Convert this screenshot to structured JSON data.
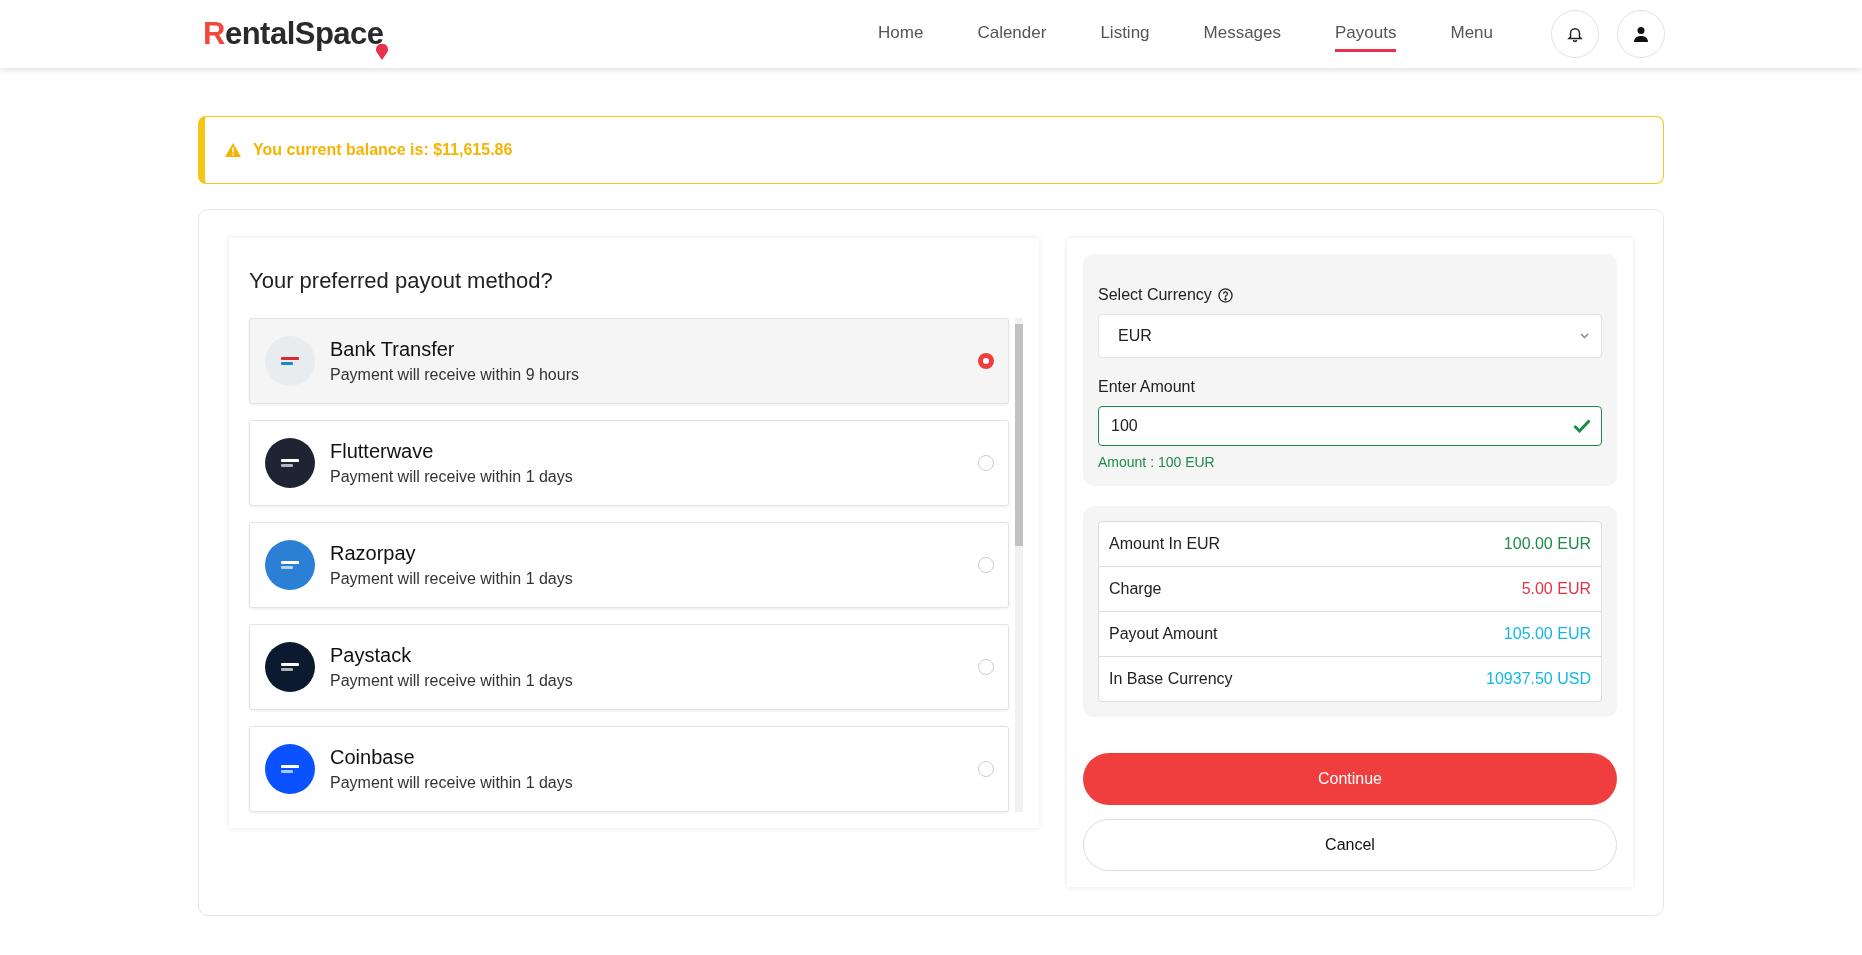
{
  "header": {
    "logo": "RentalSpace",
    "nav": [
      {
        "label": "Home",
        "selected": false
      },
      {
        "label": "Calender",
        "selected": false
      },
      {
        "label": "Listing",
        "selected": false
      },
      {
        "label": "Messages",
        "selected": false
      },
      {
        "label": "Payouts",
        "selected": true
      },
      {
        "label": "Menu",
        "selected": false
      }
    ]
  },
  "alert": {
    "text": "You current balance is: $11,615.86"
  },
  "methods": {
    "title": "Your preferred payout method?",
    "items": [
      {
        "name": "Bank Transfer",
        "note": "Payment will receive within 9 hours",
        "color": "#e8ecef",
        "selected": true
      },
      {
        "name": "Flutterwave",
        "note": "Payment will receive within 1 days",
        "color": "#1f2433",
        "selected": false
      },
      {
        "name": "Razorpay",
        "note": "Payment will receive within 1 days",
        "color": "#2b7fd4",
        "selected": false
      },
      {
        "name": "Paystack",
        "note": "Payment will receive within 1 days",
        "color": "#0b1a2e",
        "selected": false
      },
      {
        "name": "Coinbase",
        "note": "Payment will receive within 1 days",
        "color": "#0a52ff",
        "selected": false
      }
    ]
  },
  "form": {
    "currency_label": "Select Currency",
    "currency": "EUR",
    "amount_label": "Enter Amount",
    "amount": "100",
    "amount_hint": "Amount : 100 EUR"
  },
  "summary": [
    {
      "label": "Amount In EUR",
      "value": "100.00 EUR",
      "color": "#1e8a4c"
    },
    {
      "label": "Charge",
      "value": "5.00 EUR",
      "color": "#dc3545"
    },
    {
      "label": "Payout Amount",
      "value": "105.00 EUR",
      "color": "#12b8e0"
    },
    {
      "label": "In Base Currency",
      "value": "10937.50 USD",
      "color": "#12b8e0"
    }
  ],
  "buttons": {
    "continue": "Continue",
    "cancel": "Cancel"
  }
}
